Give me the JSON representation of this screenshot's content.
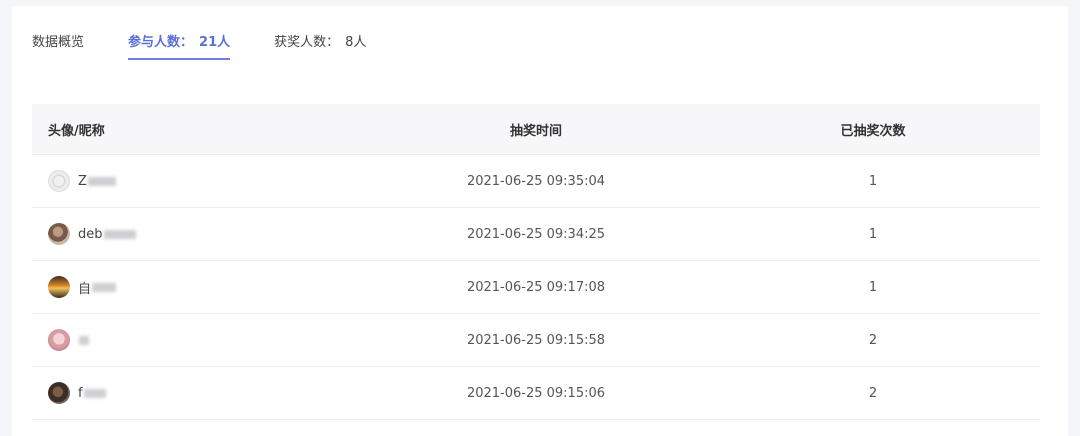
{
  "tabs": {
    "overview": "数据概览",
    "participants": {
      "label": "参与人数：",
      "value": "21人"
    },
    "winners": {
      "label": "获奖人数：",
      "value": "8人"
    }
  },
  "table": {
    "headers": [
      "头像/昵称",
      "抽奖时间",
      "已抽奖次数"
    ],
    "rows": [
      {
        "nickname": "Z",
        "time": "2021-06-25 09:35:04",
        "count": "1"
      },
      {
        "nickname": "deb",
        "time": "2021-06-25 09:34:25",
        "count": "1"
      },
      {
        "nickname": "自",
        "time": "2021-06-25 09:17:08",
        "count": "1"
      },
      {
        "nickname": "",
        "time": "2021-06-25 09:15:58",
        "count": "2"
      },
      {
        "nickname": "f",
        "time": "2021-06-25 09:15:06",
        "count": "2"
      }
    ]
  }
}
